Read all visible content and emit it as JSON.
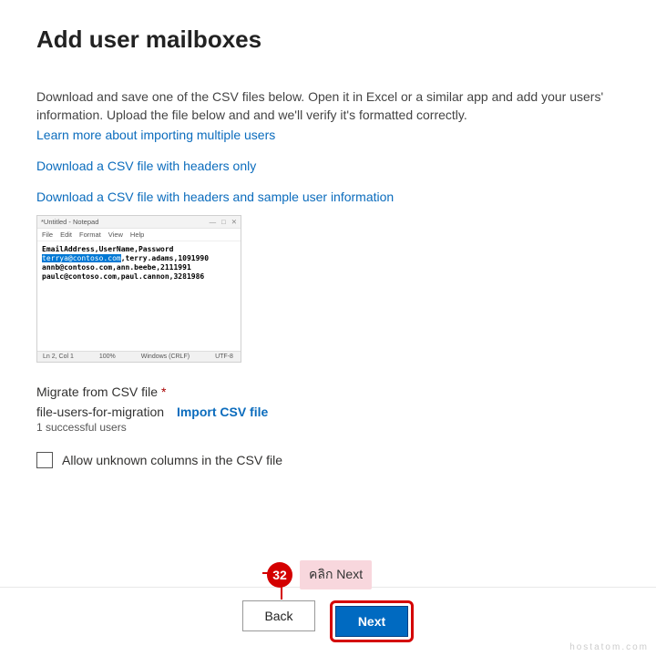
{
  "title": "Add user mailboxes",
  "intro": "Download and save one of the CSV files below. Open it in Excel or a similar app and add your users' information. Upload the file below and and we'll verify it's formatted correctly.",
  "links": {
    "learn": "Learn more about importing multiple users",
    "dl_headers": "Download a CSV file with headers only",
    "dl_sample": "Download a CSV file with headers and sample user information"
  },
  "notepad": {
    "title": "*Untitled - Notepad",
    "menus": [
      "File",
      "Edit",
      "Format",
      "View",
      "Help"
    ],
    "header_line": "EmailAddress,UserName,Password",
    "hl": "terrya@contoso.com",
    "line1_rest": ",terry.adams,1091990",
    "line2": "annb@contoso.com,ann.beebe,2111991",
    "line3": "paulc@contoso.com,paul.cannon,3281986",
    "status": {
      "pos": "Ln 2, Col 1",
      "zoom": "100%",
      "crlf": "Windows (CRLF)",
      "enc": "UTF-8"
    },
    "ctrls": {
      "min": "—",
      "max": "□",
      "close": "✕"
    }
  },
  "migrate": {
    "label": "Migrate from CSV file",
    "asterisk": "*",
    "file": "file-users-for-migration",
    "import": "Import CSV file",
    "status": "1 successful users",
    "allow_unknown": "Allow unknown columns in the CSV file"
  },
  "callout": {
    "num": "32",
    "text": "คลิก Next"
  },
  "buttons": {
    "back": "Back",
    "next": "Next"
  },
  "watermark": "hostatom.com"
}
